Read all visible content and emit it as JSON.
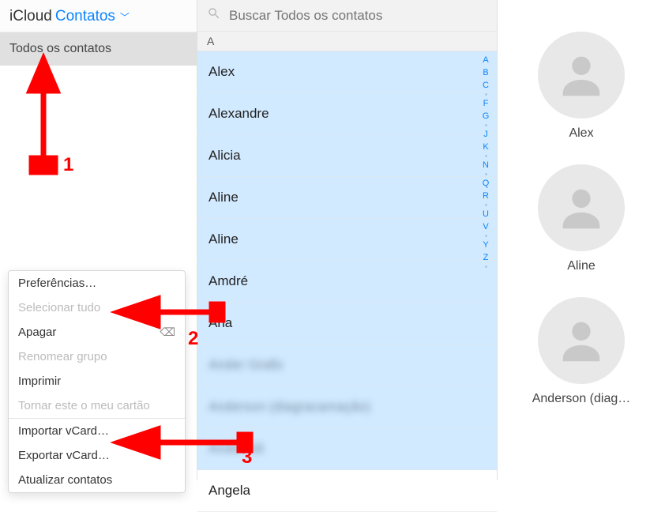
{
  "header": {
    "brand": "iCloud",
    "section": "Contatos"
  },
  "sidebar": {
    "group_label": "Todos os contatos"
  },
  "search": {
    "placeholder": "Buscar Todos os contatos"
  },
  "list": {
    "section_letter": "A",
    "items": [
      {
        "name": "Alex",
        "blurred": false
      },
      {
        "name": "Alexandre",
        "blurred": false
      },
      {
        "name": "Alicia",
        "blurred": false
      },
      {
        "name": "Aline",
        "blurred": false
      },
      {
        "name": "Aline",
        "blurred": false
      },
      {
        "name": "Amdré",
        "blurred": false
      },
      {
        "name": "Ana",
        "blurred": false
      },
      {
        "name": "Ander Grafic",
        "blurred": true
      },
      {
        "name": "Anderson (diagracamação)",
        "blurred": true
      },
      {
        "name": "Ander sili",
        "blurred": true
      },
      {
        "name": "Angela",
        "blurred": false
      }
    ]
  },
  "alpha_index": [
    "A",
    "B",
    "C",
    "",
    "F",
    "G",
    "",
    "J",
    "K",
    "",
    "N",
    "",
    "Q",
    "R",
    "",
    "U",
    "V",
    "",
    "Y",
    "Z",
    ""
  ],
  "cards": [
    {
      "name": "Alex"
    },
    {
      "name": "Aline"
    },
    {
      "name": "Anderson (diag…"
    }
  ],
  "menu": {
    "preferences": "Preferências…",
    "select_all": "Selecionar tudo",
    "delete": "Apagar",
    "rename_group": "Renomear grupo",
    "print": "Imprimir",
    "make_my_card": "Tornar este o meu cartão",
    "import_vcard": "Importar vCard…",
    "export_vcard": "Exportar vCard…",
    "refresh": "Atualizar contatos"
  },
  "annotations": {
    "n1": "1",
    "n2": "2",
    "n3": "3"
  }
}
